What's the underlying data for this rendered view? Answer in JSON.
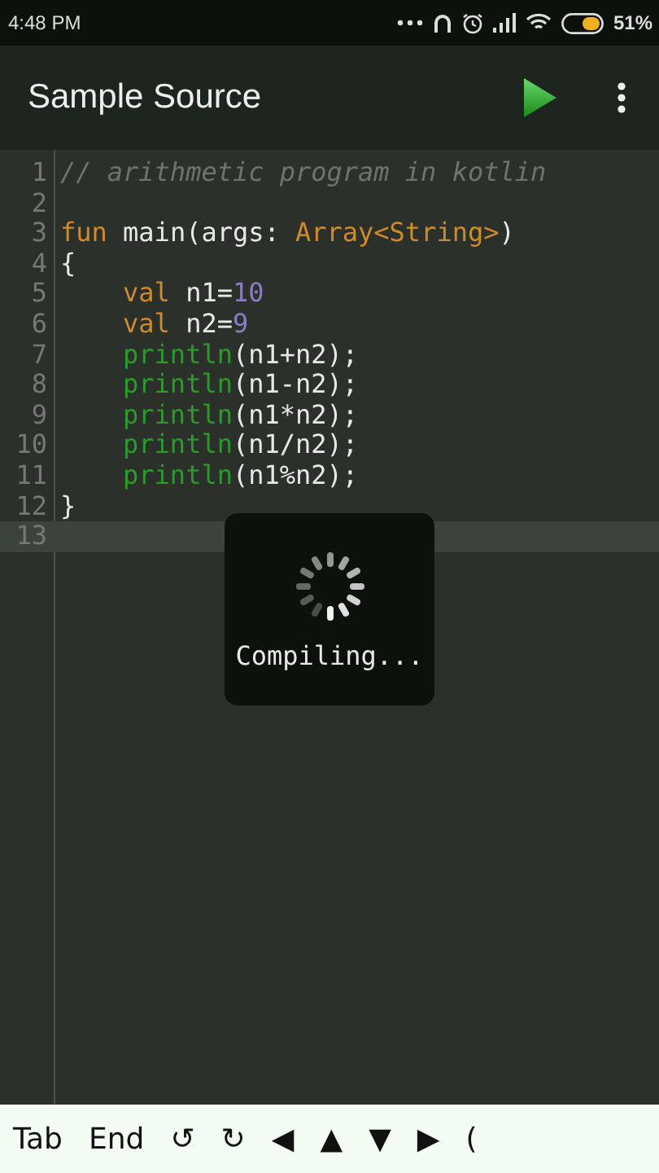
{
  "status_bar": {
    "time": "4:48 PM",
    "battery_percent": "51%"
  },
  "toolbar": {
    "title": "Sample Source"
  },
  "editor": {
    "lines": [
      {
        "number": "1",
        "current": false,
        "tokens": [
          {
            "kind": "comment",
            "text": "// arithmetic program in kotlin"
          }
        ]
      },
      {
        "number": "2",
        "current": false
      },
      {
        "number": "3",
        "current": false,
        "tokens": [
          {
            "kind": "keyword",
            "text": "fun"
          },
          {
            "kind": "plain",
            "text": " main(args: "
          },
          {
            "kind": "type",
            "text": "Array<String>"
          },
          {
            "kind": "plain",
            "text": ")"
          }
        ]
      },
      {
        "number": "4",
        "current": false,
        "tokens": [
          {
            "kind": "plain",
            "text": "{"
          }
        ]
      },
      {
        "number": "5",
        "current": false,
        "tokens": [
          {
            "kind": "keyword",
            "text": "    val"
          },
          {
            "kind": "plain",
            "text": " n1="
          },
          {
            "kind": "number",
            "text": "10"
          }
        ]
      },
      {
        "number": "6",
        "current": false,
        "tokens": [
          {
            "kind": "keyword",
            "text": "    val"
          },
          {
            "kind": "plain",
            "text": " n2="
          },
          {
            "kind": "number",
            "text": "9"
          }
        ]
      },
      {
        "number": "7",
        "current": false,
        "tokens": [
          {
            "kind": "function",
            "text": "    println"
          },
          {
            "kind": "plain",
            "text": "(n1+n2);"
          }
        ]
      },
      {
        "number": "8",
        "current": false,
        "tokens": [
          {
            "kind": "function",
            "text": "    println"
          },
          {
            "kind": "plain",
            "text": "(n1-n2);"
          }
        ]
      },
      {
        "number": "9",
        "current": false,
        "tokens": [
          {
            "kind": "function",
            "text": "    println"
          },
          {
            "kind": "plain",
            "text": "(n1*n2);"
          }
        ]
      },
      {
        "number": "10",
        "current": false,
        "tokens": [
          {
            "kind": "function",
            "text": "    println"
          },
          {
            "kind": "plain",
            "text": "(n1/n2);"
          }
        ]
      },
      {
        "number": "11",
        "current": false,
        "tokens": [
          {
            "kind": "function",
            "text": "    println"
          },
          {
            "kind": "plain",
            "text": "(n1%n2);"
          }
        ]
      },
      {
        "number": "12",
        "current": false,
        "tokens": [
          {
            "kind": "plain",
            "text": "}"
          }
        ]
      },
      {
        "number": "13",
        "current": true
      }
    ]
  },
  "progress_dialog": {
    "message": "Compiling..."
  },
  "key_bar": {
    "keys": [
      "Tab",
      "End",
      "↺",
      "↻",
      "◀",
      "▲",
      "▼",
      "▶",
      "("
    ]
  }
}
